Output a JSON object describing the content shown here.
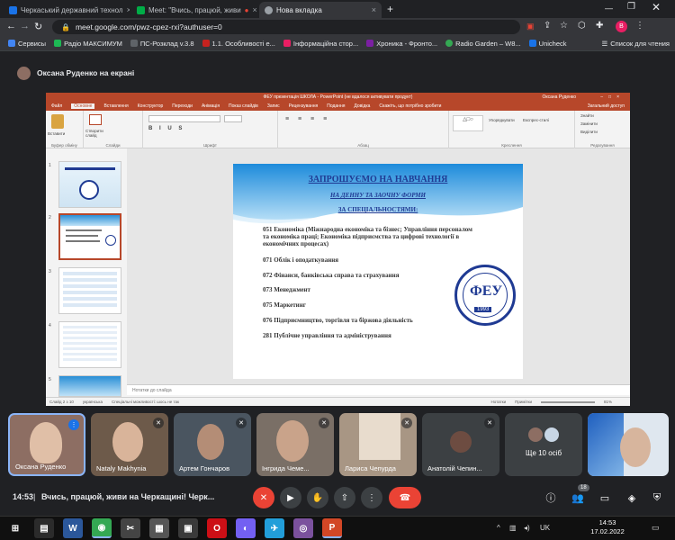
{
  "browser": {
    "tabs": [
      {
        "title": "Черкаський державний технол",
        "favicon_color": "#1a73e8"
      },
      {
        "title": "Meet: \"Вчись, працюй, живи",
        "favicon_color": "#00ac47"
      },
      {
        "title": "Нова вкладка",
        "favicon_color": "#9aa0a6"
      }
    ],
    "new_tab": "+",
    "url": "meet.google.com/pwz-cpez-rxi?authuser=0",
    "profile_letter": "В",
    "bookmarks": [
      {
        "label": "Сервисы",
        "color": "#4285f4"
      },
      {
        "label": "Радіо МАКСИМУМ",
        "color": "#1db954"
      },
      {
        "label": "ПС-Розклад v.3.8",
        "color": "#5f6368"
      },
      {
        "label": "1.1. Особливості е...",
        "color": "#c5221f"
      },
      {
        "label": "Інформаційна стор...",
        "color": "#e91e63"
      },
      {
        "label": "Хроника - Фронто...",
        "color": "#7b1fa2"
      },
      {
        "label": "Radio Garden – W8...",
        "color": "#34a853"
      },
      {
        "label": "Unicheck",
        "color": "#1a73e8"
      }
    ],
    "reading_list": "Список для чтения"
  },
  "meet": {
    "presenter_label": "Оксана Руденко на екрані",
    "meeting_time": "14:53",
    "meeting_title": "Вчись, працюй, живи на Черкащині! Черк...",
    "participants_count": "18",
    "tiles": [
      {
        "name": "Оксана Руденко",
        "bg": "#8d6e63"
      },
      {
        "name": "Nataly Makhynia",
        "bg": "#6d5a4a"
      },
      {
        "name": "Артем Гончаров",
        "bg": "#4a5560"
      },
      {
        "name": "Інгрида Чеме...",
        "bg": "#7a6f66"
      },
      {
        "name": "Лариса Чепурда",
        "bg": "#a89684"
      },
      {
        "name": "Анатолій Чепин...",
        "bg": "#3c4043"
      },
      {
        "name": "Ще 10 осіб",
        "bg": "#3c4043"
      },
      {
        "name": "",
        "bg": "#dfe7ef"
      }
    ]
  },
  "ppt": {
    "title": "ФЕУ презентація ШКОЛА - PowerPoint (не вдалося активувати продукт)",
    "user": "Оксана Руденко",
    "tabs": [
      "Файл",
      "Основне",
      "Вставлення",
      "Конструктор",
      "Переходи",
      "Анімація",
      "Показ слайдів",
      "Запис",
      "Рецензування",
      "Подання",
      "Довідка",
      "Скажіть, що потрібно зробити"
    ],
    "share": "Загальний доступ",
    "ribbon_groups": [
      "Буфер обміну",
      "Слайди",
      "Шрифт",
      "Абзац",
      "Креслення",
      "Редагування"
    ],
    "ribbon_buttons": {
      "paste": "Вставити",
      "new_slide": "Створити слайд",
      "find": "Знайти",
      "replace": "Замінити",
      "select": "Виділити",
      "arrange": "Упорядкувати",
      "styles": "Експрес-стилі"
    },
    "notes_placeholder": "Нотатки до слайда",
    "status": {
      "slide": "Слайд 2 з 10",
      "lang": "українська",
      "accessibility": "Спеціальні можливості: шось не так",
      "notes": "Нотатки",
      "comments": "Примітки",
      "zoom": "81%"
    },
    "thumbnail_numbers": [
      "1",
      "2",
      "3",
      "4",
      "5"
    ]
  },
  "slide": {
    "heading": "ЗАПРОШУЄМО НА НАВЧАННЯ",
    "sub1": "НА ДЕННУ ТА ЗАОЧНУ ФОРМИ",
    "sub2": "ЗА СПЕЦІАЛЬНОСТЯМИ:",
    "items": [
      "051 Економіка (Міжнародна економіка та бізнес; Управління персоналом та економіка праці; Економіка підприємства та цифрові технології в економічних процесах)",
      "071 Облік і оподаткування",
      "072 Фінанси, банківська справа та страхування",
      "073 Менеджмент",
      "075 Маркетинг",
      "076 Підприємництво, торгівля та біржова діяльність",
      "281 Публічне управління та адміністрування"
    ],
    "logo_letters": "ФЕУ",
    "logo_year": "1993"
  },
  "taskbar": {
    "apps": [
      {
        "label": "⊞",
        "color": "#101010"
      },
      {
        "label": "▤",
        "color": "#2b2b2b"
      },
      {
        "label": "W",
        "color": "#2b579a"
      },
      {
        "label": "◉",
        "color": "#34a853"
      },
      {
        "label": "✂",
        "color": "#444"
      },
      {
        "label": "▦",
        "color": "#555"
      },
      {
        "label": "▣",
        "color": "#3a3a3a"
      },
      {
        "label": "O",
        "color": "#cc0f16"
      },
      {
        "label": "◐",
        "color": "#7360f2"
      },
      {
        "label": "✈",
        "color": "#229ed9"
      },
      {
        "label": "◎",
        "color": "#7b519d"
      },
      {
        "label": "P",
        "color": "#d24726"
      }
    ],
    "lang": "UK",
    "time": "14:53",
    "date": "17.02.2022"
  }
}
